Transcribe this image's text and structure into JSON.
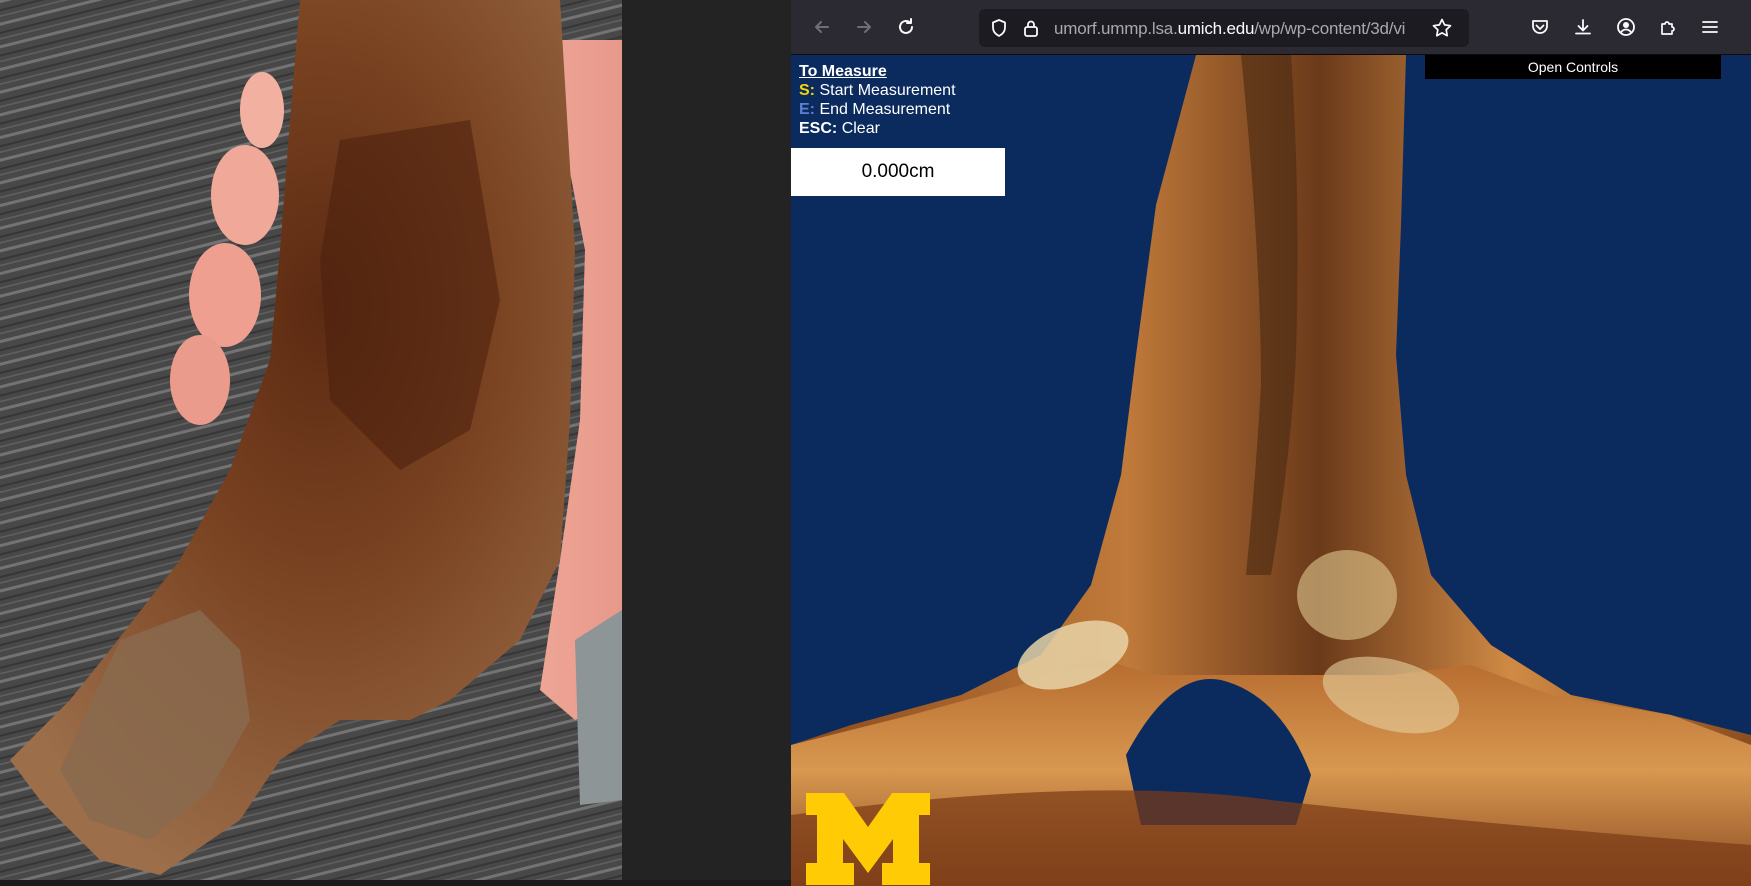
{
  "browser": {
    "url_prefix": "umorf.ummp.lsa.",
    "url_domain": "umich.edu",
    "url_suffix": "/wp/wp-content/3d/vi",
    "icons": [
      "back-arrow-icon",
      "forward-arrow-icon",
      "reload-icon",
      "shield-icon",
      "lock-icon",
      "star-icon",
      "pocket-icon",
      "download-icon",
      "account-icon",
      "extensions-icon",
      "menu-icon"
    ]
  },
  "viewer": {
    "instructions": {
      "title": "To Measure",
      "start_key": "S:",
      "start_label": "Start Measurement",
      "end_key": "E:",
      "end_label": "End Measurement",
      "clear_key": "ESC:",
      "clear_label": "Clear"
    },
    "measurement_value": "0.000cm",
    "open_controls_label": "Open Controls",
    "background_color": "#0b2a5e"
  },
  "colors": {
    "toolbar": "#2b2a33",
    "urlbar": "#1c1b22",
    "logo_maize": "#ffcb05"
  }
}
